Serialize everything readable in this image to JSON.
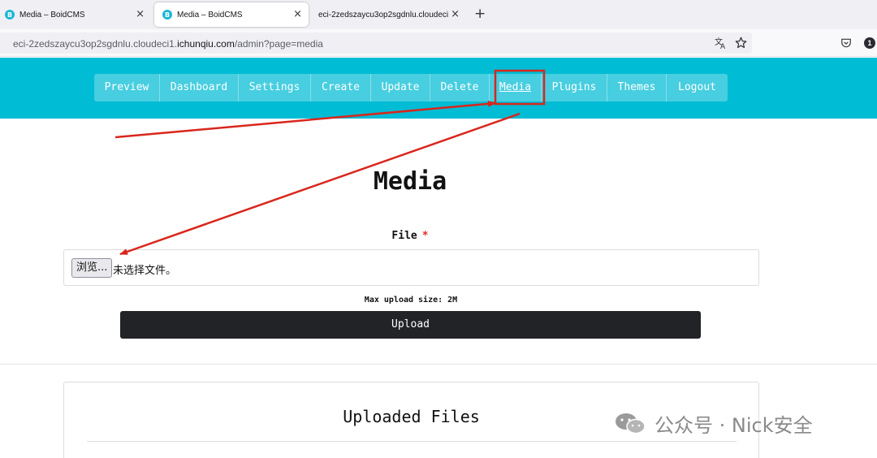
{
  "browser": {
    "tabs": [
      {
        "title": "Media – BoidCMS",
        "favicon": "B",
        "active": false
      },
      {
        "title": "Media – BoidCMS",
        "favicon": "B",
        "active": true
      },
      {
        "title": "eci-2zedszaycu3op2sgdnlu.cloudeci1.ichunqiu.com",
        "favicon": "",
        "active": false
      }
    ],
    "close_glyph": "×",
    "new_tab_glyph": "+",
    "url_prefix": "eci-2zedszaycu3op2sgdnlu.cloudeci1.",
    "url_host": "ichunqiu.com",
    "url_path": "/admin?page=media",
    "icons": {
      "translate": "translate-icon",
      "bookmark": "star-icon",
      "pocket": "pocket-icon",
      "notifications": "notification-badge-icon"
    },
    "notification_count": "1"
  },
  "colors": {
    "header": "#00bcd4",
    "annotation": "#d9261c",
    "upload_button": "#222326",
    "required": "#e0302b"
  },
  "nav": {
    "items": [
      "Preview",
      "Dashboard",
      "Settings",
      "Create",
      "Update",
      "Delete",
      "Media",
      "Plugins",
      "Themes",
      "Logout"
    ],
    "active": "Media"
  },
  "main": {
    "title": "Media",
    "file_label": "File",
    "required_mark": "*",
    "browse_label": "浏览...",
    "no_file_text": "未选择文件。",
    "max_size_text": "Max upload size: 2M",
    "upload_label": "Upload",
    "uploaded_files_title": "Uploaded Files"
  },
  "watermark": {
    "text": "公众号 · Nick安全"
  }
}
